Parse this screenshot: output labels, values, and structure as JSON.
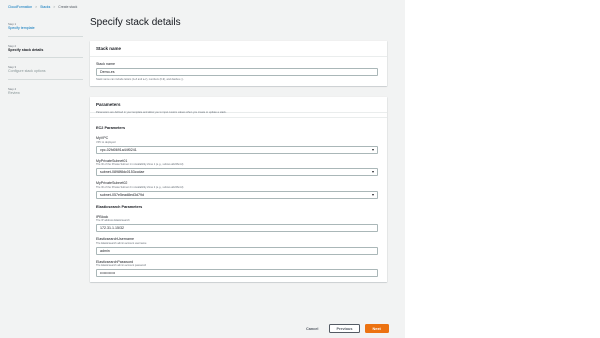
{
  "breadcrumb": [
    "CloudFormation",
    "Stacks",
    "Create stack"
  ],
  "steps": [
    {
      "num": "Step 1",
      "label": "Specify template",
      "state": "done"
    },
    {
      "num": "Step 2",
      "label": "Specify stack details",
      "state": "current"
    },
    {
      "num": "Step 3",
      "label": "Configure stack options",
      "state": "pending"
    },
    {
      "num": "Step 4",
      "label": "Review",
      "state": "pending"
    }
  ],
  "page_title": "Specify stack details",
  "stack_name_card": {
    "header": "Stack name",
    "field_label": "Stack name",
    "value": "Demo-es",
    "hint": "Stack name can include letters (A-Z and a-z), numbers (0-9), and dashes (-)."
  },
  "parameters_card": {
    "header": "Parameters",
    "description": "Parameters are defined in your template and allow you to input custom values when you create or update a stack.",
    "sections": [
      {
        "title": "EC2 Parameters",
        "fields": [
          {
            "label": "MyVPC",
            "desc": "VPC to deployed",
            "value": "vpc-02fd0691a44f0241",
            "select": true
          },
          {
            "label": "MyPrivateSubnet01",
            "desc": "The ID of the Private Subnet 1 in Availability Zone 1 (e.g., subnet-a0246ccd)",
            "value": "subnet-0898f8dc0153ccdae",
            "select": true
          },
          {
            "label": "MyPrivateSubnet02",
            "desc": "The ID of the Private Subnet 2 in Availability Zone 2 (e.g., subnet-a0246ccd)",
            "value": "subnet-057e5ead8ed3d79d",
            "select": true
          }
        ]
      },
      {
        "title": "Elasticsearch Parameters",
        "fields": [
          {
            "label": "IPBlock",
            "desc": "The IP address Elasticsearch",
            "value": "172.31.1.15/32",
            "select": false
          },
          {
            "label": "ElasticsearchUsername",
            "desc": "The Elasticsearch admin account username",
            "value": "admin",
            "select": false
          },
          {
            "label": "ElasticsearchPassword",
            "desc": "The Elasticsearch admin account password",
            "value": "••••••••••••",
            "select": false
          }
        ]
      }
    ]
  },
  "actions": {
    "cancel": "Cancel",
    "previous": "Previous",
    "next": "Next"
  },
  "colors": {
    "link": "#0073bb",
    "primary_button": "#ec7211",
    "page_bg": "#f2f3f3"
  }
}
